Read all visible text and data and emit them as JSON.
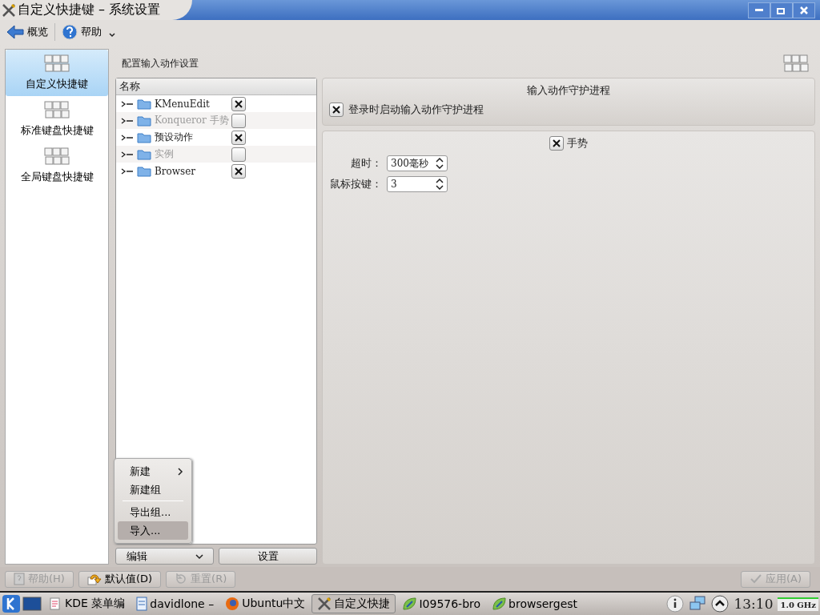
{
  "window": {
    "title": "自定义快捷键 – 系统设置"
  },
  "toolbar": {
    "items": [
      {
        "kind": "back",
        "label": "概览"
      },
      {
        "kind": "help",
        "label": "帮助"
      }
    ]
  },
  "sidebar": {
    "items": [
      {
        "label": "自定义快捷键",
        "selected": true
      },
      {
        "label": "标准键盘快捷键",
        "selected": false
      },
      {
        "label": "全局键盘快捷键",
        "selected": false
      }
    ]
  },
  "page_title": "配置输入动作设置",
  "tree": {
    "columns": [
      "名称"
    ],
    "rows": [
      {
        "name": "KMenuEdit",
        "checked": true,
        "disabled": false
      },
      {
        "name": "Konqueror 手势",
        "checked": false,
        "disabled": true
      },
      {
        "name": "预设动作",
        "checked": true,
        "disabled": false
      },
      {
        "name": "实例",
        "checked": false,
        "disabled": true
      },
      {
        "name": "Browser",
        "checked": true,
        "disabled": false
      }
    ]
  },
  "edit_menu": {
    "items": [
      {
        "label": "新建",
        "submenu": true,
        "selected": false
      },
      {
        "label": "新建组",
        "submenu": false,
        "selected": false
      },
      {
        "kind": "separator"
      },
      {
        "label": "导出组...",
        "submenu": false,
        "selected": false
      },
      {
        "label": "导入...",
        "submenu": false,
        "selected": true
      }
    ]
  },
  "tree_buttons": [
    {
      "label": "编辑",
      "dropdown": true
    },
    {
      "label": "设置",
      "dropdown": false
    }
  ],
  "daemon_group": {
    "title": "输入动作守护进程",
    "option": {
      "label": "登录时启动输入动作守护进程",
      "checked": true
    }
  },
  "gestures_group": {
    "title": "手势",
    "checked": true,
    "fields": [
      {
        "label": "超时：",
        "value": "300毫秒"
      },
      {
        "label": "鼠标按键：",
        "value": "3"
      }
    ]
  },
  "dialog_buttons": [
    {
      "kind": "help",
      "label": "帮助(H)",
      "disabled": true
    },
    {
      "kind": "defaults",
      "label": "默认值(D)",
      "disabled": false
    },
    {
      "kind": "reset",
      "label": "重置(R)",
      "disabled": true
    },
    {
      "kind": "apply",
      "label": "应用(A)",
      "disabled": true
    }
  ],
  "taskbar": {
    "tasks": [
      {
        "kind": "editor",
        "label": "KDE 菜单编",
        "selected": false
      },
      {
        "kind": "files",
        "label": "davidlone –",
        "selected": false
      },
      {
        "kind": "browser",
        "label": "Ubuntu中文",
        "selected": false
      },
      {
        "kind": "tools",
        "label": "自定义快捷",
        "selected": true
      },
      {
        "kind": "leaf",
        "label": "I09576-bro",
        "selected": false
      },
      {
        "kind": "leaf",
        "label": "browsergest",
        "selected": false
      }
    ],
    "clock": "13:10",
    "cpu": "1.0 GHz"
  }
}
